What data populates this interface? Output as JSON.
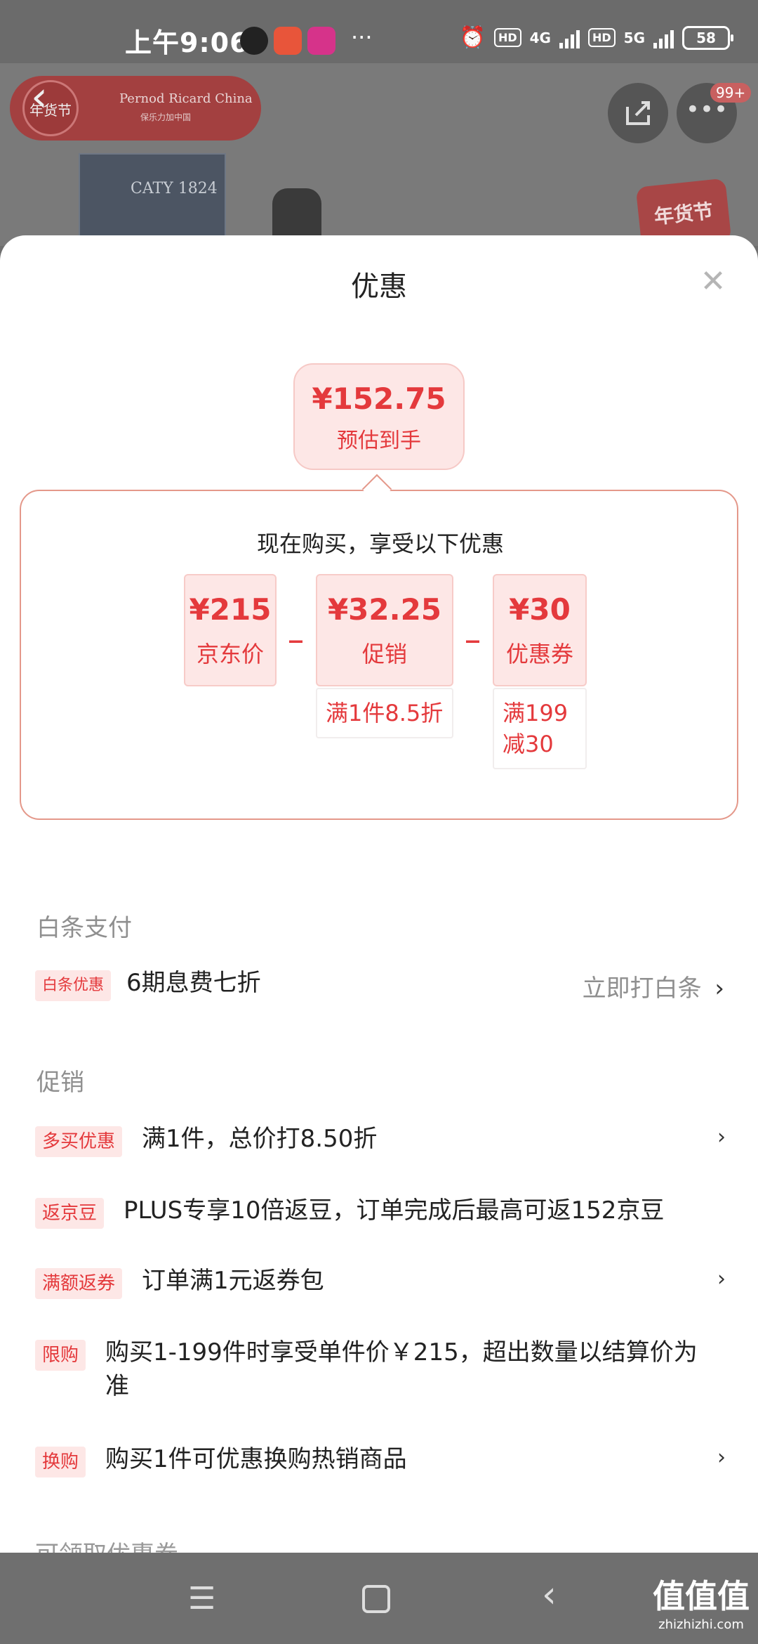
{
  "status_bar": {
    "time": "上午9:06",
    "network_1": "4G",
    "network_2": "5G",
    "hd_label": "HD",
    "battery": "58",
    "dots": "···"
  },
  "product_header": {
    "brand_name": "Pernod Ricard China",
    "brand_sub": "保乐力加中国",
    "brand_badge": "年货节",
    "box_text": "CATY 1824",
    "more_badge": "99+",
    "promo_tag": "年货节"
  },
  "sheet": {
    "title": "优惠",
    "close_icon": "close-icon",
    "estimate": {
      "price": "¥152.75",
      "label": "预估到手"
    },
    "breakdown": {
      "title": "现在购买，享受以下优惠",
      "items": [
        {
          "amount": "¥215",
          "label": "京东价"
        },
        {
          "amount": "¥32.25",
          "label": "促销",
          "detail": "满1件8.5折"
        },
        {
          "amount": "¥30",
          "label": "优惠券",
          "detail": "满199\n减30"
        }
      ],
      "operator": "_"
    },
    "baitiao": {
      "section_title": "白条支付",
      "tag": "白条优惠",
      "text": "6期息费七折",
      "link": "立即打白条",
      "chevron": "›"
    },
    "promotions": {
      "section_title": "促销",
      "items": [
        {
          "tag": "多买优惠",
          "text": "满1件，总价打8.50折",
          "chevron": "›"
        },
        {
          "tag": "返京豆",
          "text": "PLUS专享10倍返豆，订单完成后最高可返152京豆"
        },
        {
          "tag": "满额返券",
          "text": "订单满1元返券包",
          "chevron": "›"
        },
        {
          "tag": "限购",
          "text": "购买1-199件时享受单件价￥215，超出数量以结算价为准"
        },
        {
          "tag": "换购",
          "text": "购买1件可优惠换购热销商品",
          "chevron": "›"
        }
      ]
    },
    "cutoff_section": "可领取优惠券"
  },
  "nav_bar": {
    "menu_icon": "menu-icon",
    "home_icon": "home-icon",
    "back_icon": "back-icon",
    "watermark": "值值值",
    "watermark_sub": "zhizhizhi.com"
  },
  "colors": {
    "accent": "#e4393c",
    "accent_bg": "#fde7e6",
    "panel_border": "#e4988a"
  }
}
